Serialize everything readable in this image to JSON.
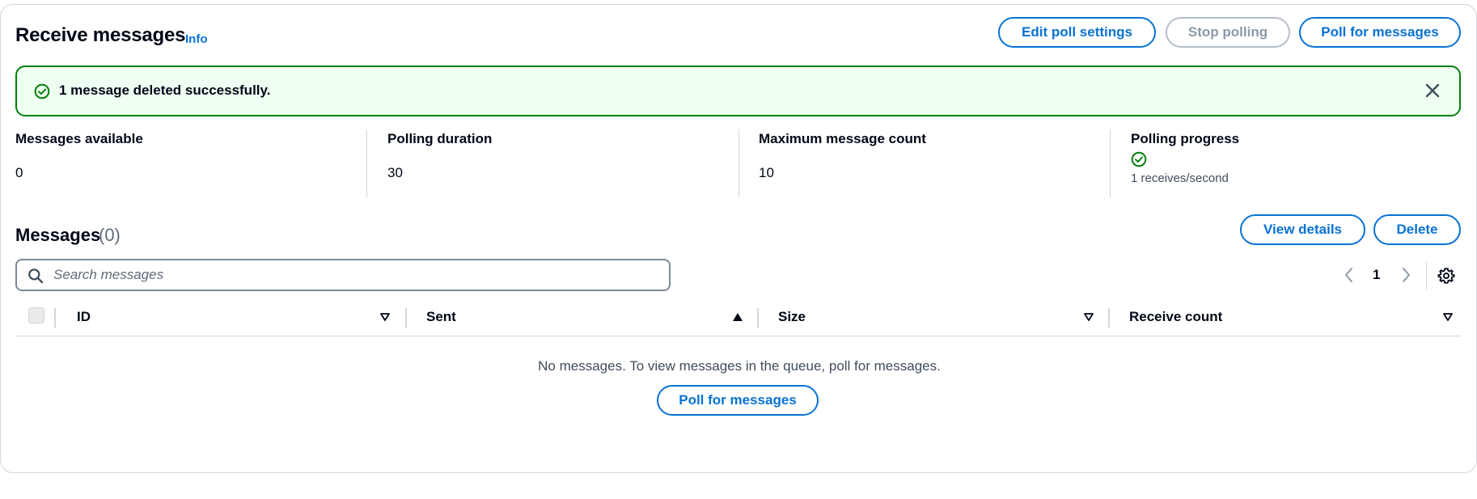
{
  "header": {
    "title": "Receive messages",
    "info_label": "Info",
    "edit_poll_settings_label": "Edit poll settings",
    "stop_polling_label": "Stop polling",
    "poll_for_messages_label": "Poll for messages"
  },
  "banner": {
    "message": "1 message deleted successfully.",
    "status_color": "#037f0c"
  },
  "stats": {
    "messages_available": {
      "label": "Messages available",
      "value": "0"
    },
    "polling_duration": {
      "label": "Polling duration",
      "value": "30"
    },
    "maximum_message_count": {
      "label": "Maximum message count",
      "value": "10"
    },
    "polling_progress": {
      "label": "Polling progress",
      "rate": "1 receives/second",
      "icon": "check-circle-icon"
    }
  },
  "messages": {
    "title": "Messages",
    "count": "(0)",
    "view_details_label": "View details",
    "delete_label": "Delete",
    "search_placeholder": "Search messages",
    "page": "1",
    "columns": [
      {
        "label": "ID",
        "sort": "none"
      },
      {
        "label": "Sent",
        "sort": "ascending"
      },
      {
        "label": "Size",
        "sort": "none"
      },
      {
        "label": "Receive count",
        "sort": "none"
      }
    ],
    "empty_text": "No messages. To view messages in the queue, poll for messages.",
    "empty_poll_label": "Poll for messages"
  },
  "colors": {
    "accent": "#0972d3",
    "success": "#037f0c",
    "success_bg": "#effff1",
    "disabled": "#8d99a8"
  }
}
